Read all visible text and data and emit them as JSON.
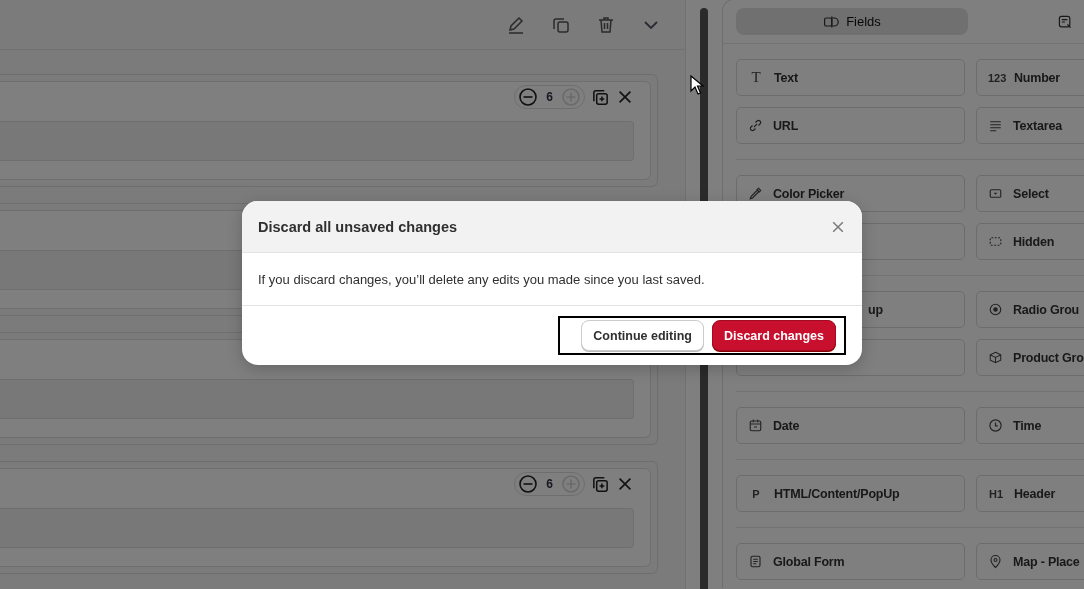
{
  "editor": {
    "blocks": [
      {
        "kind": "stepper",
        "count": "6",
        "plus_disabled": true
      },
      {
        "kind": "plain"
      },
      {
        "kind": "plain"
      },
      {
        "kind": "stepper",
        "count": "6",
        "plus_disabled": true
      }
    ]
  },
  "palette": {
    "tabs": [
      {
        "label": "Fields",
        "selected": true,
        "kind": "fields"
      },
      {
        "selected": false,
        "kind": "form"
      }
    ],
    "groups": [
      {
        "items": [
          {
            "label": "Text",
            "icon_text": "T"
          },
          {
            "label": "Number",
            "icon_text": "123"
          },
          {
            "label": "URL",
            "kind": "link"
          },
          {
            "label": "Textarea",
            "kind": "lines"
          }
        ]
      },
      {
        "items": [
          {
            "label": "Color Picker",
            "kind": "eyedropper"
          },
          {
            "label": "Select",
            "kind": "select"
          },
          {
            "kind": "covered"
          },
          {
            "label": "Hidden",
            "kind": "dashed"
          }
        ]
      },
      {
        "items": [
          {
            "label": "up",
            "kind": "covered"
          },
          {
            "label": "Radio Grou",
            "kind": "radio"
          },
          {
            "kind": "covered"
          },
          {
            "label": "Product Gro",
            "kind": "box"
          }
        ]
      },
      {
        "items": [
          {
            "label": "Date",
            "kind": "calendar"
          },
          {
            "label": "Time",
            "kind": "clock"
          }
        ]
      },
      {
        "items": [
          {
            "label": "HTML/Content/PopUp",
            "icon_text": "P"
          },
          {
            "label": "Header",
            "icon_text": "H1"
          }
        ]
      },
      {
        "items": [
          {
            "label": "Global Form",
            "kind": "form"
          },
          {
            "label": "Map - Place",
            "kind": "pin"
          }
        ]
      }
    ]
  },
  "dialog": {
    "title": "Discard all unsaved changes",
    "message": "If you discard changes, you’ll delete any edits you made since you last saved.",
    "actions_focused": true,
    "buttons": [
      {
        "label": "Continue editing",
        "kind": "secondary"
      },
      {
        "label": "Discard changes",
        "kind": "danger"
      }
    ]
  }
}
